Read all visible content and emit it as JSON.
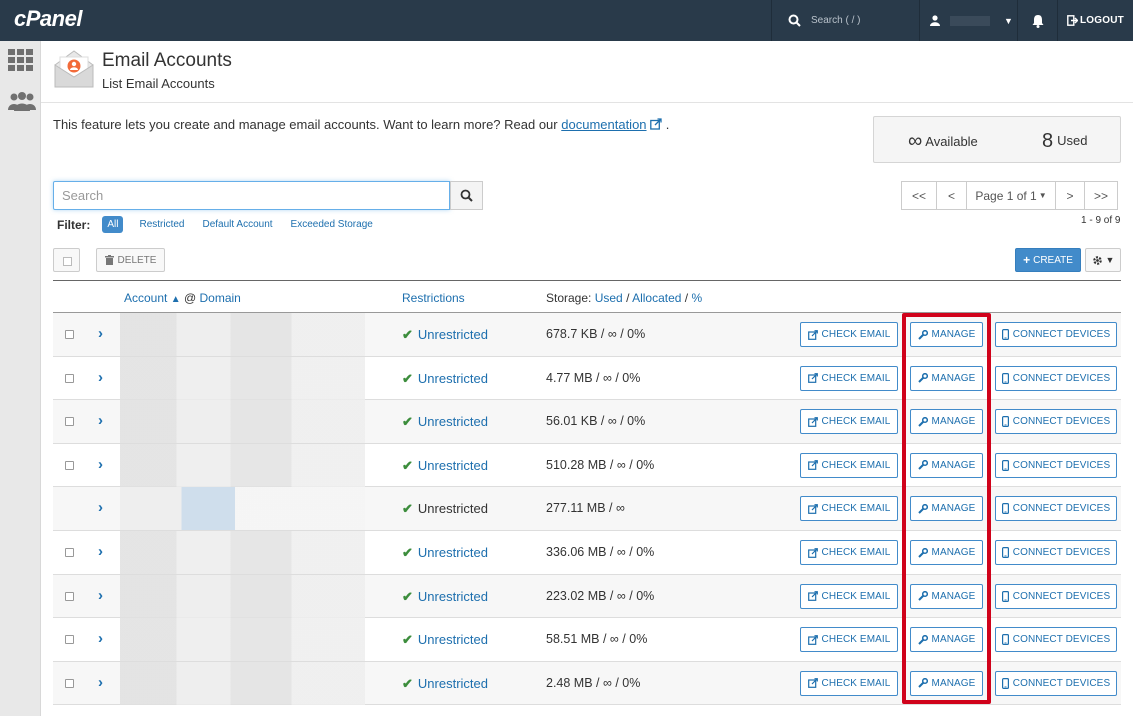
{
  "topbar": {
    "logo": "cPanel",
    "search_placeholder": "Search ( / )",
    "logout_label": "LOGOUT"
  },
  "header": {
    "title": "Email Accounts",
    "subtitle": "List Email Accounts"
  },
  "intro": {
    "text": "This feature lets you create and manage email accounts. Want to learn more? Read our",
    "link": "documentation",
    "suffix": "."
  },
  "stats": {
    "available_value": "∞",
    "available_label": "Available",
    "used_value": "8",
    "used_label": "Used"
  },
  "search": {
    "placeholder": "Search"
  },
  "filter": {
    "label": "Filter:",
    "options": [
      "All",
      "Restricted",
      "Default Account",
      "Exceeded Storage"
    ],
    "selected": "All"
  },
  "pagination": {
    "first": "<<",
    "prev": "<",
    "page": "Page 1 of 1",
    "next": ">",
    "last": ">>",
    "count": "1 - 9 of 9"
  },
  "toolbar": {
    "delete_label": "DELETE",
    "create_label": "CREATE"
  },
  "table": {
    "headers": {
      "account": "Account",
      "at": "@",
      "domain": "Domain",
      "restrictions": "Restrictions",
      "storage_prefix": "Storage:",
      "used": "Used",
      "allocated": "Allocated",
      "percent": "%"
    },
    "action_labels": {
      "check_email": "CHECK EMAIL",
      "manage": "MANAGE",
      "connect_devices": "CONNECT DEVICES"
    },
    "rows": [
      {
        "restriction": "Unrestricted",
        "storage": "678.7 KB / ∞ / 0%"
      },
      {
        "restriction": "Unrestricted",
        "storage": "4.77 MB / ∞ / 0%"
      },
      {
        "restriction": "Unrestricted",
        "storage": "56.01 KB / ∞ / 0%"
      },
      {
        "restriction": "Unrestricted",
        "storage": "510.28 MB / ∞ / 0%"
      },
      {
        "restriction": "Unrestricted",
        "storage": "277.11 MB / ∞"
      },
      {
        "restriction": "Unrestricted",
        "storage": "336.06 MB / ∞ / 0%"
      },
      {
        "restriction": "Unrestricted",
        "storage": "223.02 MB / ∞ / 0%"
      },
      {
        "restriction": "Unrestricted",
        "storage": "58.51 MB / ∞ / 0%"
      },
      {
        "restriction": "Unrestricted",
        "storage": "2.48 MB / ∞ / 0%"
      }
    ]
  },
  "colors": {
    "topbar": "#293a4a",
    "accent": "#428bca",
    "highlight": "#d0021b"
  }
}
